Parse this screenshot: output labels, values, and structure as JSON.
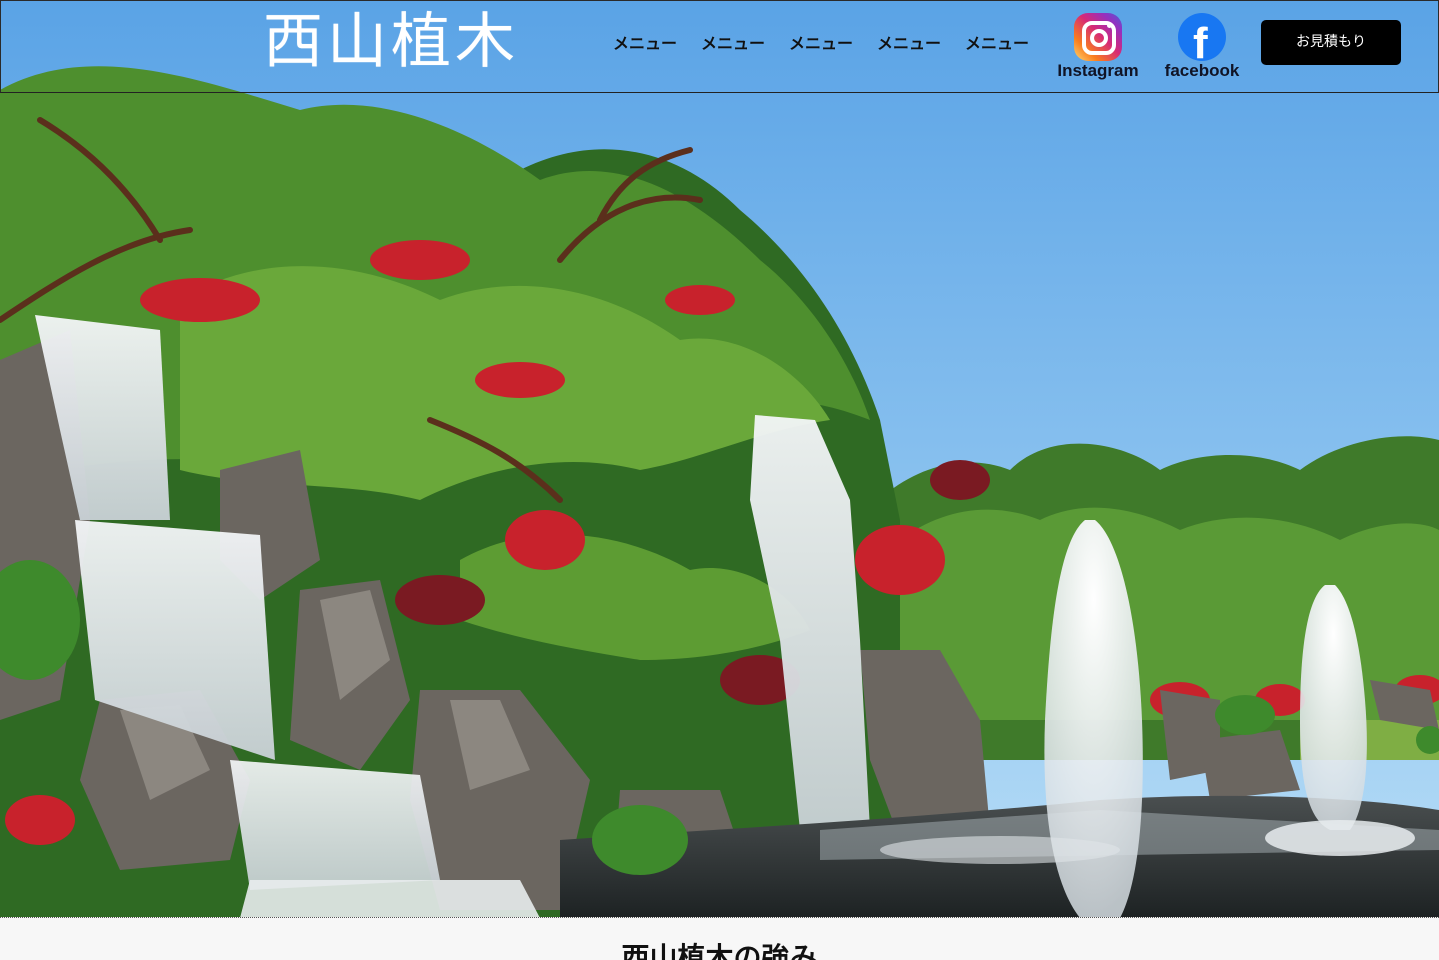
{
  "brand": {
    "logo_text": "西山植木"
  },
  "nav": {
    "items": [
      {
        "label": "メニュー"
      },
      {
        "label": "メニュー"
      },
      {
        "label": "メニュー"
      },
      {
        "label": "メニュー"
      },
      {
        "label": "メニュー"
      }
    ]
  },
  "social": {
    "instagram": {
      "label": "Instagram",
      "icon": "instagram-icon"
    },
    "facebook": {
      "label": "facebook",
      "icon": "facebook-icon"
    }
  },
  "cta": {
    "quote_label": "お見積もり"
  },
  "hero": {
    "image": "japanese-garden-waterfall-fountains"
  },
  "section": {
    "title": "西山植木の強み"
  },
  "colors": {
    "sky_top": "#5aa5e8",
    "sky_bottom": "#9fd0f5",
    "button_bg": "#000000",
    "facebook_blue": "#1877f2"
  }
}
